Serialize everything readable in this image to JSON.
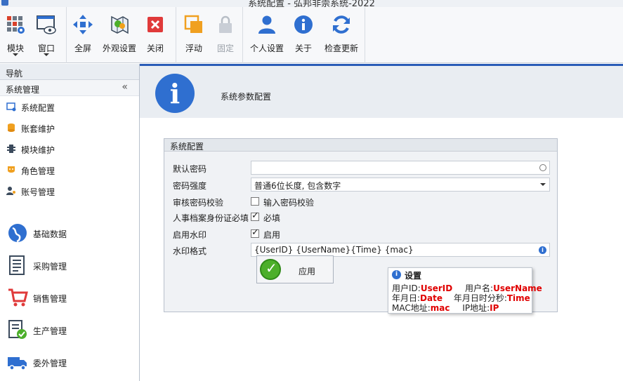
{
  "window": {
    "title": "系统配置 - 弘邦非崇系统-2022"
  },
  "ribbon": {
    "buttons": [
      {
        "label": "模块",
        "icon": "modules-icon"
      },
      {
        "label": "窗口",
        "icon": "window-icon"
      },
      {
        "label": "全屏",
        "icon": "fullscreen-icon"
      },
      {
        "label": "外观设置",
        "icon": "appearance-icon"
      },
      {
        "label": "关闭",
        "icon": "close-icon"
      },
      {
        "label": "浮动",
        "icon": "float-icon"
      },
      {
        "label": "固定",
        "icon": "lock-icon"
      },
      {
        "label": "个人设置",
        "icon": "user-icon"
      },
      {
        "label": "关于",
        "icon": "info-icon"
      },
      {
        "label": "检查更新",
        "icon": "refresh-icon"
      }
    ]
  },
  "sidebar": {
    "header": "导航",
    "group": "系统管理",
    "collapse_glyph": "«",
    "items": [
      {
        "label": "系统配置"
      },
      {
        "label": "账套维护"
      },
      {
        "label": "模块维护"
      },
      {
        "label": "角色管理"
      },
      {
        "label": "账号管理"
      }
    ],
    "modules": [
      {
        "label": "基础数据"
      },
      {
        "label": "采购管理"
      },
      {
        "label": "销售管理"
      },
      {
        "label": "生产管理"
      },
      {
        "label": "委外管理"
      }
    ]
  },
  "page": {
    "title": "系统参数配置",
    "info_glyph": "i",
    "group_title": "系统配置",
    "fields": {
      "default_password": {
        "label": "默认密码",
        "value": ""
      },
      "password_strength": {
        "label": "密码强度",
        "value": "普通6位长度, 包含数字"
      },
      "audit_password": {
        "label": "审核密码校验",
        "checkbox_label": "输入密码校验",
        "checked": false
      },
      "hr_id_required": {
        "label": "人事档案身份证必填",
        "checkbox_label": "必填",
        "checked": true
      },
      "enable_watermark": {
        "label": "启用水印",
        "checkbox_label": "启用",
        "checked": true
      },
      "watermark_format": {
        "label": "水印格式",
        "value": "{UserID} {UserName}{Time} {mac}"
      }
    },
    "apply_label": "应用"
  },
  "tooltip": {
    "title": "设置",
    "line1_key1": "用户ID:",
    "line1_val1": "UserID",
    "line1_key2": "用户名:",
    "line1_val2": "UserName",
    "line2_key1": "年月日:",
    "line2_val1": "Date",
    "line2_key2": "年月日时分秒:",
    "line2_val2": "Time",
    "line3_key1": "MAC地址:",
    "line3_val1": "mac",
    "line3_key2": "IP地址:",
    "line3_val2": "IP"
  },
  "colors": {
    "accent": "#2a5cb7",
    "highlight": "#e00000"
  }
}
